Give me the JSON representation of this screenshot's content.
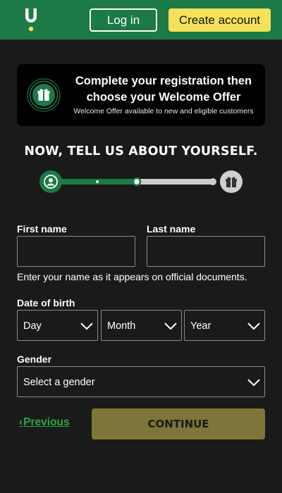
{
  "header": {
    "login_label": "Log in",
    "create_account_label": "Create account",
    "brand_color": "#1b7a45",
    "cta_color": "#f5e25a"
  },
  "promo": {
    "title_line1": "Complete your registration then",
    "title_line2": "choose your Welcome Offer",
    "subtitle": "Welcome Offer available to new and eligible customers",
    "icon": "gift-icon"
  },
  "section_title": "NOW, TELL US ABOUT YOURSELF.",
  "progress": {
    "steps": [
      "user-icon",
      "gift-icon"
    ],
    "completed_fraction": 0.5
  },
  "form": {
    "first_name_label": "First name",
    "first_name_value": "",
    "last_name_label": "Last name",
    "last_name_value": "",
    "name_hint": "Enter your name as it appears on official documents.",
    "dob_label": "Date of birth",
    "day_placeholder": "Day",
    "month_placeholder": "Month",
    "year_placeholder": "Year",
    "gender_label": "Gender",
    "gender_placeholder": "Select a gender"
  },
  "actions": {
    "previous_label": "Previous",
    "continue_label": "CONTINUE"
  }
}
